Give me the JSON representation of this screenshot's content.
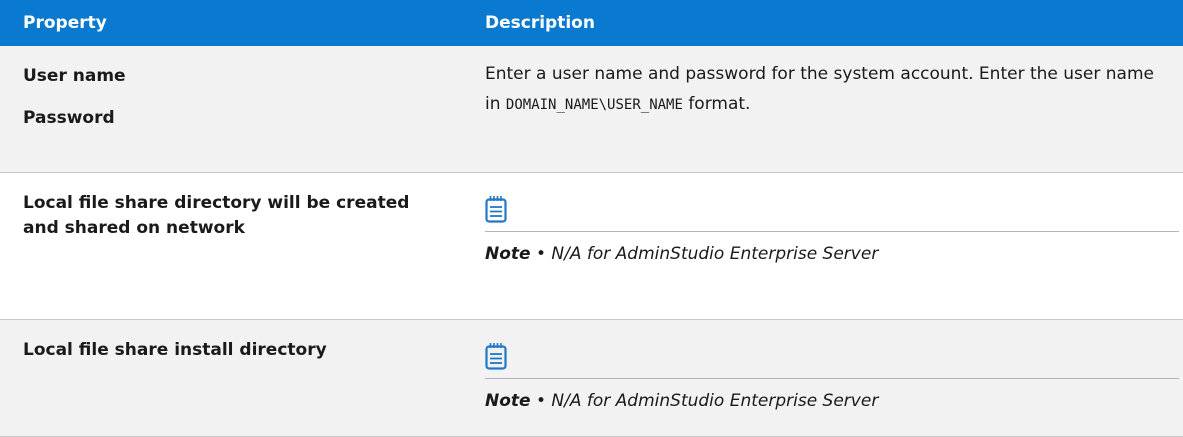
{
  "table": {
    "headers": {
      "property": "Property",
      "description": "Description"
    },
    "rows": [
      {
        "property_lines": [
          "User name",
          "Password"
        ],
        "description": {
          "text_before": "Enter a user name and password for the system account. Enter the user name in ",
          "code": "DOMAIN_NAME\\USER_NAME",
          "text_after": " format."
        }
      },
      {
        "property": "Local file share directory will be created and shared on network",
        "note": {
          "icon": "notepad-icon",
          "label": "Note",
          "separator": " • ",
          "text": "N/A for AdminStudio Enterprise Server"
        }
      },
      {
        "property": "Local file share install directory",
        "note": {
          "icon": "notepad-icon",
          "label": "Note",
          "separator": " • ",
          "text": "N/A for AdminStudio Enterprise Server"
        }
      }
    ]
  },
  "colors": {
    "header_bg": "#0a7ad1",
    "header_text": "#ffffff",
    "row_alt_bg": "#f2f2f2",
    "icon_color": "#1f78c8"
  }
}
